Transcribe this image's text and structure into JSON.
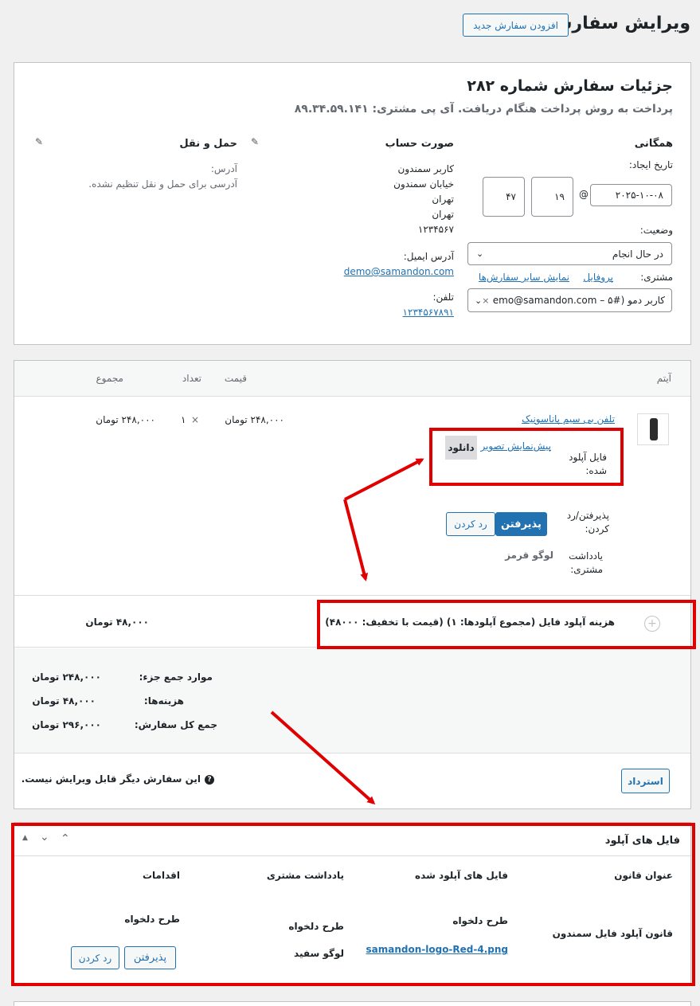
{
  "header": {
    "title": "ویرایش سفارش",
    "add_new_label": "افزودن سفارش جدید"
  },
  "order": {
    "heading": "جزئیات سفارش شماره ۲۸۲",
    "subheading": "پرداخت به روش پرداخت هنگام دریافت. آی پی مشتری: ۸۹.۳۴.۵۹.۱۴۱",
    "general": {
      "title": "همگانی",
      "date_label": "تاریخ ایجاد:",
      "date_value": "۲۰۲۵-۱۰-۰۸",
      "at": "@",
      "hour": "۱۹",
      "minute": "۴۷",
      "status_label": "وضعیت:",
      "status_value": "در حال انجام",
      "customer_label": "مشتری:",
      "profile_link": "پروفایل",
      "other_orders_link": "نمایش سایر سفارش‌ها",
      "customer_value": "کاربر دمو (#۵ – demo@samandon.com…"
    },
    "billing": {
      "title": "صورت حساب",
      "address_lines": [
        "کاربر سمندون",
        "خیابان سمندون",
        "تهران",
        "تهران",
        "۱۲۳۴۵۶۷"
      ],
      "email_label": "آدرس ایمیل:",
      "email": "demo@samandon.com",
      "phone_label": "تلفن:",
      "phone": "۱۲۳۴۵۶۷۸۹۱"
    },
    "shipping": {
      "title": "حمل و نقل",
      "address_label": "آدرس:",
      "address_value": "آدرسی برای حمل و نقل تنظیم نشده."
    }
  },
  "items": {
    "headers": {
      "item": "آیتم",
      "price": "قیمت",
      "qty": "تعداد",
      "total": "مجموع"
    },
    "product": {
      "name": "تلفن بی سیم پاناسونیک",
      "price": "۲۴۸,۰۰۰ تومان",
      "qty_x": "×",
      "qty": "۱",
      "total": "۲۴۸,۰۰۰ تومان",
      "upload_label": "فایل آپلود شده:",
      "preview_link": "پیش‌نمایش تصویر",
      "download_label": "دانلود",
      "accept_reject_label": "پذیرفتن/رد کردن:",
      "accept_label": "پذیرفتن",
      "reject_label": "رد کردن",
      "note_label": "یادداشت مشتری:",
      "note_value": "لوگو قرمز"
    },
    "fee": {
      "label": "هزینه آپلود فایل (مجموع آپلودها: ۱) (قیمت با تخفیف: ۴۸۰۰۰)",
      "total": "۴۸,۰۰۰ تومان"
    },
    "totals": [
      {
        "label": "موارد جمع جزء:",
        "value": "۲۴۸,۰۰۰ تومان"
      },
      {
        "label": "هزینه‌ها:",
        "value": "۴۸,۰۰۰ تومان"
      },
      {
        "label": "جمع کل سفارش:",
        "value": "۲۹۶,۰۰۰ تومان"
      }
    ],
    "refund_label": "استرداد",
    "not_editable": "این سفارش دیگر قابل ویرایش نیست."
  },
  "uploads": {
    "title": "فایل های آپلود",
    "headers": {
      "rule": "عنوان قانون",
      "files": "فایل های آپلود شده",
      "note": "یادداشت مشتری",
      "actions": "اقدامات"
    },
    "row": {
      "rule": "قانون آپلود فایل سمندون",
      "file_title": "طرح دلخواه",
      "file_link": "samandon-logo-Red-4.png",
      "note_title": "طرح دلخواه",
      "note_value": "لوگو سفید",
      "action_title": "طرح دلخواه",
      "accept_label": "پذیرفتن",
      "reject_label": "رد کردن"
    }
  },
  "colors": {
    "annotation": "#e00000",
    "link": "#2271b1"
  }
}
